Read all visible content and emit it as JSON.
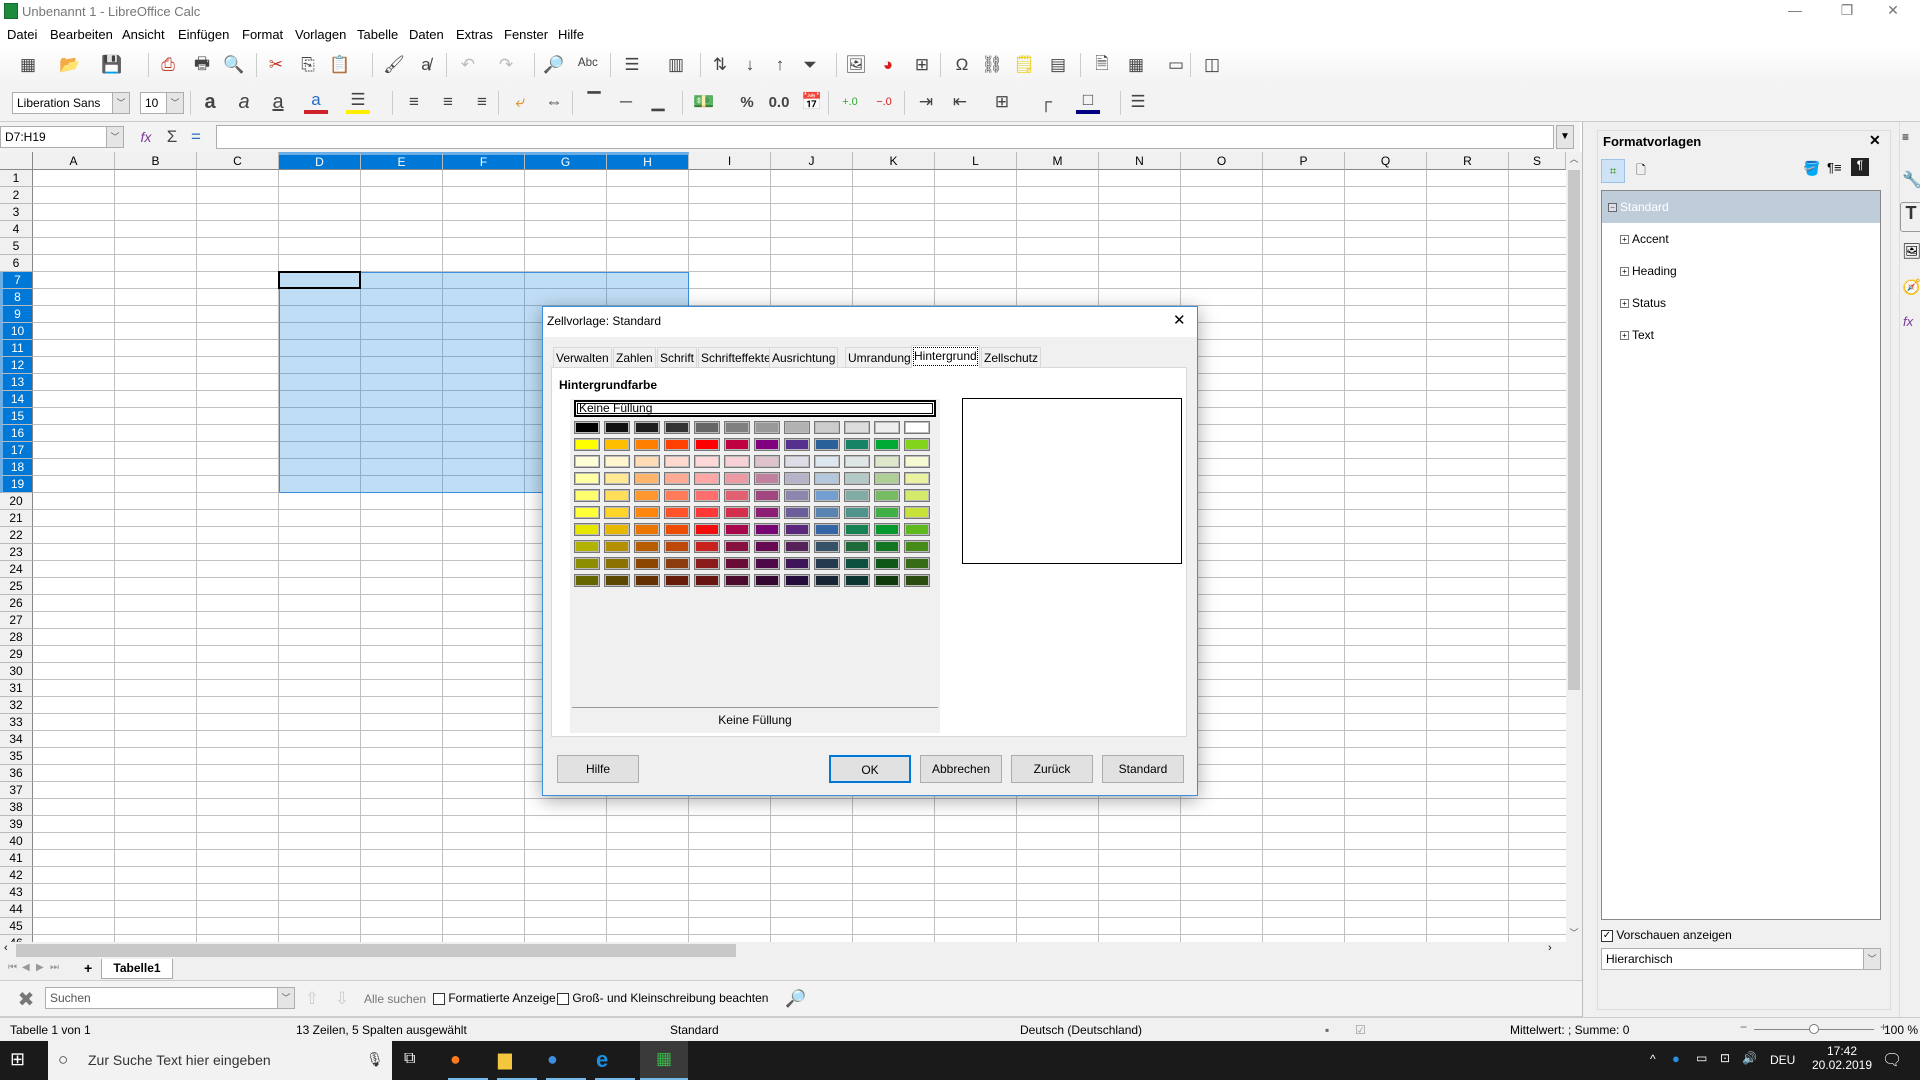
{
  "window": {
    "title": "Unbenannt 1 - LibreOffice Calc",
    "controls": {
      "minimize": "—",
      "maximize": "❐",
      "close": "✕"
    }
  },
  "menu": [
    "Datei",
    "Bearbeiten",
    "Ansicht",
    "Einfügen",
    "Format",
    "Vorlagen",
    "Tabelle",
    "Daten",
    "Extras",
    "Fenster",
    "Hilfe"
  ],
  "toolbar_standard": [
    {
      "name": "new-icon",
      "glyph": "▦"
    },
    {
      "name": "open-icon",
      "glyph": "📂"
    },
    {
      "name": "save-icon",
      "glyph": "💾"
    },
    {
      "name": "export-pdf-icon",
      "glyph": "⎙"
    },
    {
      "name": "print-icon",
      "glyph": "🖶"
    },
    {
      "name": "print-preview-icon",
      "glyph": "🔍"
    },
    {
      "name": "cut-icon",
      "glyph": "✂"
    },
    {
      "name": "copy-icon",
      "glyph": "⎘"
    },
    {
      "name": "paste-icon",
      "glyph": "📋"
    },
    {
      "name": "clone-formatting-icon",
      "glyph": "🖌"
    },
    {
      "name": "clear-formatting-icon",
      "glyph": "a̸"
    },
    {
      "name": "undo-icon",
      "glyph": "↶"
    },
    {
      "name": "redo-icon",
      "glyph": "↷"
    },
    {
      "name": "find-replace-icon",
      "glyph": "🔎"
    },
    {
      "name": "spelling-icon",
      "glyph": "ᴬᵇᶜ"
    },
    {
      "name": "row-icon",
      "glyph": "☰"
    },
    {
      "name": "column-icon",
      "glyph": "▥"
    },
    {
      "name": "sort-icon",
      "glyph": "⇅"
    },
    {
      "name": "sort-ascending-icon",
      "glyph": "↓"
    },
    {
      "name": "sort-descending-icon",
      "glyph": "↑"
    },
    {
      "name": "autofilter-icon",
      "glyph": "⏷"
    },
    {
      "name": "insert-image-icon",
      "glyph": "🖼"
    },
    {
      "name": "insert-chart-icon",
      "glyph": "◕"
    },
    {
      "name": "pivot-table-icon",
      "glyph": "⊞"
    },
    {
      "name": "special-character-icon",
      "glyph": "Ω"
    },
    {
      "name": "hyperlink-icon",
      "glyph": "⛓"
    },
    {
      "name": "comment-icon",
      "glyph": "🗒"
    },
    {
      "name": "headers-footers-icon",
      "glyph": "▤"
    },
    {
      "name": "define-print-area-icon",
      "glyph": "🗎"
    },
    {
      "name": "freeze-rows-columns-icon",
      "glyph": "▦"
    },
    {
      "name": "split-window-icon",
      "glyph": "▭"
    },
    {
      "name": "show-draw-functions-icon",
      "glyph": "◫"
    }
  ],
  "toolbar_formatting": {
    "font_name": "Liberation Sans",
    "font_size": "10",
    "icons": [
      {
        "name": "bold-icon",
        "glyph": "a"
      },
      {
        "name": "italic-icon",
        "glyph": "a"
      },
      {
        "name": "underline-icon",
        "glyph": "a"
      },
      {
        "name": "font-color-icon",
        "glyph": "a"
      },
      {
        "name": "background-color-icon",
        "glyph": "☰"
      },
      {
        "name": "align-left-icon",
        "glyph": "≡"
      },
      {
        "name": "align-center-icon",
        "glyph": "≡"
      },
      {
        "name": "align-right-icon",
        "glyph": "≡"
      },
      {
        "name": "wrap-text-icon",
        "glyph": "⤶"
      },
      {
        "name": "merge-center-icon",
        "glyph": "⇔"
      },
      {
        "name": "align-top-icon",
        "glyph": "▔"
      },
      {
        "name": "align-middle-icon",
        "glyph": "─"
      },
      {
        "name": "align-bottom-icon",
        "glyph": "▁"
      },
      {
        "name": "currency-format-icon",
        "glyph": "💵"
      },
      {
        "name": "percent-format-icon",
        "glyph": "%"
      },
      {
        "name": "number-format-icon",
        "glyph": "0.0"
      },
      {
        "name": "date-format-icon",
        "glyph": "📅"
      },
      {
        "name": "add-decimal-icon",
        "glyph": "+.0"
      },
      {
        "name": "delete-decimal-icon",
        "glyph": "−.0"
      },
      {
        "name": "increase-indent-icon",
        "glyph": "⇥"
      },
      {
        "name": "decrease-indent-icon",
        "glyph": "⇤"
      },
      {
        "name": "borders-icon",
        "glyph": "⊞"
      },
      {
        "name": "border-style-icon",
        "glyph": "┌"
      },
      {
        "name": "border-color-icon",
        "glyph": "□"
      },
      {
        "name": "conditional-format-icon",
        "glyph": "☰"
      }
    ],
    "font_color": "#d0202a",
    "highlight_color": "#ffee00",
    "border_color": "#000080"
  },
  "formula_bar": {
    "name_box": "D7:H19",
    "content": ""
  },
  "grid": {
    "columns": [
      "A",
      "B",
      "C",
      "D",
      "E",
      "F",
      "G",
      "H",
      "I",
      "J",
      "K",
      "L",
      "M",
      "N",
      "O",
      "P",
      "Q",
      "R",
      "S"
    ],
    "selected_columns": [
      "D",
      "E",
      "F",
      "G",
      "H"
    ],
    "rows_visible": 46,
    "selected_rows": [
      7,
      19
    ],
    "active_cell": "D7"
  },
  "sheet_tabs": {
    "nav": [
      "⏮",
      "◀",
      "▶",
      "⏭"
    ],
    "add": "+",
    "tabs": [
      "Tabelle1"
    ]
  },
  "find_bar": {
    "placeholder": "Suchen",
    "find_all": "Alle suchen",
    "formatted_display": "Formatierte Anzeige",
    "match_case": "Groß- und Kleinschreibung beachten"
  },
  "status_bar": {
    "sheet": "Tabelle 1 von 1",
    "selection": "13 Zeilen, 5 Spalten ausgewählt",
    "page_style": "Standard",
    "language": "Deutsch (Deutschland)",
    "summary": "Mittelwert: ; Summe: 0",
    "zoom": "100 %",
    "zoom_level_percent": 100
  },
  "sidebar": {
    "title": "Formatvorlagen",
    "tree": [
      {
        "label": "Standard",
        "expanded": true,
        "selected": true
      },
      {
        "label": "Accent",
        "expanded": false
      },
      {
        "label": "Heading",
        "expanded": false
      },
      {
        "label": "Status",
        "expanded": false
      },
      {
        "label": "Text",
        "expanded": false
      }
    ],
    "show_previews": "Vorschauen anzeigen",
    "show_previews_checked": true,
    "filter": "Hierarchisch"
  },
  "dialog": {
    "title": "Zellvorlage: Standard",
    "tabs": [
      "Verwalten",
      "Zahlen",
      "Schrift",
      "Schrifteffekte",
      "Ausrichtung",
      "Umrandung",
      "Hintergrund",
      "Zellschutz"
    ],
    "active_tab": "Hintergrund",
    "section_label": "Hintergrundfarbe",
    "color_field": "Keine Füllung",
    "selected_color_label": "Keine Füllung",
    "palette": [
      [
        "#000000",
        "#111111",
        "#1c1c1c",
        "#333333",
        "#666666",
        "#808080",
        "#999999",
        "#b2b2b2",
        "#cccccc",
        "#dddddd",
        "#eeeeee",
        "#ffffff"
      ],
      [
        "#ffff00",
        "#ffbf00",
        "#ff8000",
        "#ff4000",
        "#ff0000",
        "#bf0041",
        "#800080",
        "#55308d",
        "#2a6099",
        "#158466",
        "#00a933",
        "#81d41a"
      ],
      [
        "#ffffd7",
        "#fff5ce",
        "#ffdbb6",
        "#ffd8ce",
        "#ffd7d7",
        "#f7d1d5",
        "#e0c2cd",
        "#dedce6",
        "#dee6ef",
        "#dee7e5",
        "#dde8cb",
        "#f6f9d4"
      ],
      [
        "#ffffa6",
        "#ffe994",
        "#ffb66c",
        "#ffaa95",
        "#ffa6a6",
        "#ec9ba4",
        "#bf819e",
        "#b7b3ca",
        "#b4c7dc",
        "#b3cac7",
        "#afd095",
        "#e8f2a1"
      ],
      [
        "#ffff6d",
        "#ffde59",
        "#ff972f",
        "#ff7b59",
        "#ff6d6d",
        "#e16173",
        "#a1467e",
        "#8e86ae",
        "#729fcf",
        "#81aca6",
        "#77bc65",
        "#d4ea6b"
      ],
      [
        "#ffff38",
        "#ffd428",
        "#ff860d",
        "#ff5429",
        "#ff3838",
        "#d62e4e",
        "#8d1d75",
        "#6b5e9b",
        "#5983b0",
        "#50938a",
        "#3faf46",
        "#c9e23a"
      ],
      [
        "#e6e600",
        "#e8b700",
        "#ea7500",
        "#ed4c05",
        "#f10d0c",
        "#a7074b",
        "#780373",
        "#5b277d",
        "#3465a4",
        "#168253",
        "#069a2e",
        "#5eb91e"
      ],
      [
        "#b2b200",
        "#b48f00",
        "#b85c00",
        "#be480a",
        "#c9211e",
        "#861141",
        "#650953",
        "#55215b",
        "#355269",
        "#1e6a39",
        "#127622",
        "#468a1a"
      ],
      [
        "#8d8d00",
        "#8c7000",
        "#8c4600",
        "#8b3b0d",
        "#8b1b1a",
        "#6a0b36",
        "#4e0a48",
        "#3d1558",
        "#243b4f",
        "#0d5040",
        "#0f5716",
        "#376c16"
      ],
      [
        "#666600",
        "#5c4700",
        "#653000",
        "#661c08",
        "#661312",
        "#4b0a2b",
        "#33072f",
        "#240d3d",
        "#162433",
        "#0b3530",
        "#0e3a0b",
        "#2a4c0f"
      ]
    ],
    "buttons": {
      "help": "Hilfe",
      "ok": "OK",
      "cancel": "Abbrechen",
      "reset": "Zurück",
      "standard": "Standard"
    },
    "close": "✕"
  },
  "taskbar": {
    "search_placeholder": "Zur Suche Text hier eingeben",
    "apps": [
      "task-view",
      "firefox",
      "file-explorer",
      "thunderbird",
      "edge",
      "libreoffice-calc"
    ],
    "tray": {
      "language": "DEU",
      "time": "17:42",
      "date": "20.02.2019"
    }
  }
}
